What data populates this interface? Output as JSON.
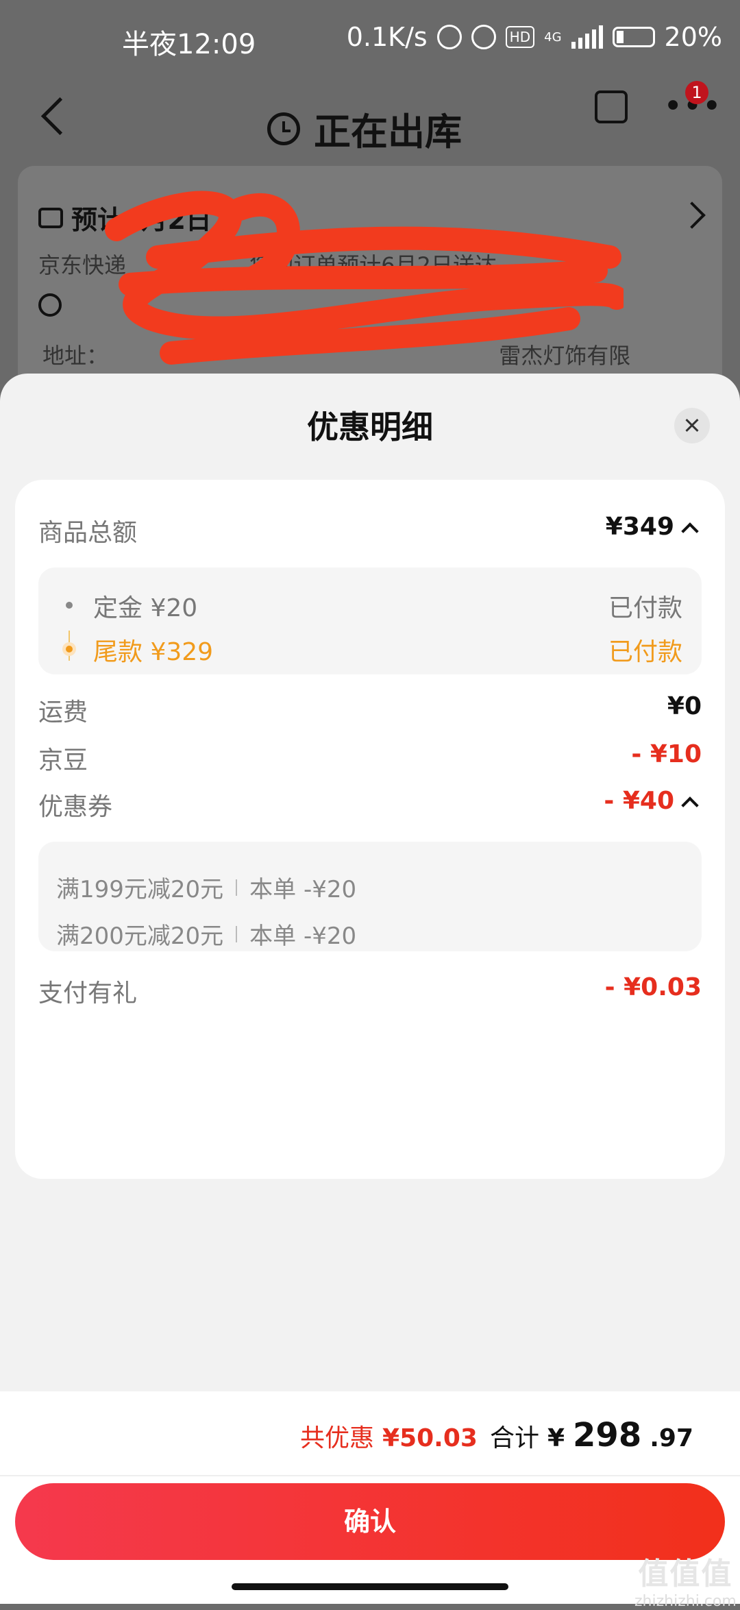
{
  "status_bar": {
    "time": "半夜12:09",
    "network_speed": "0.1K/s",
    "network_type": "4G",
    "hd": "HD",
    "battery": "20%"
  },
  "header": {
    "title": "正在出库",
    "badge_count": "1"
  },
  "background_card": {
    "eta": "预计6月2日",
    "message": "京东快递",
    "message_tail": "您的订单预计6月2日送达",
    "address_prefix": "地址：",
    "address_tail": "雷杰灯饰有限"
  },
  "sheet": {
    "title": "优惠明细",
    "goods_total_label": "商品总额",
    "goods_total_value": "¥349",
    "deposit_label": "定金 ¥20",
    "deposit_status": "已付款",
    "balance_label": "尾款 ¥329",
    "balance_status": "已付款",
    "shipping_label": "运费",
    "shipping_value": "¥0",
    "jingdou_label": "京豆",
    "jingdou_value": "- ¥10",
    "coupon_label": "优惠券",
    "coupon_value": "- ¥40",
    "coupons": [
      {
        "name": "满199元减20元",
        "amount": "本单 -¥20"
      },
      {
        "name": "满200元减20元",
        "amount": "本单 -¥20"
      }
    ],
    "pay_gift_label": "支付有礼",
    "pay_gift_value": "- ¥0.03"
  },
  "footer": {
    "discount_label": "共优惠",
    "discount_value": "¥50.03",
    "total_label": "合计",
    "total_currency": "¥",
    "total_integer": "298",
    "total_decimal": ".97",
    "confirm_label": "确认"
  },
  "watermark": {
    "line1": "值值值",
    "line2": "zhizhizhi.com"
  },
  "colors": {
    "accent_red": "#e62e1e",
    "orange": "#f19b1c",
    "button_gradient_start": "#f5394d",
    "button_gradient_end": "#f2301b"
  }
}
